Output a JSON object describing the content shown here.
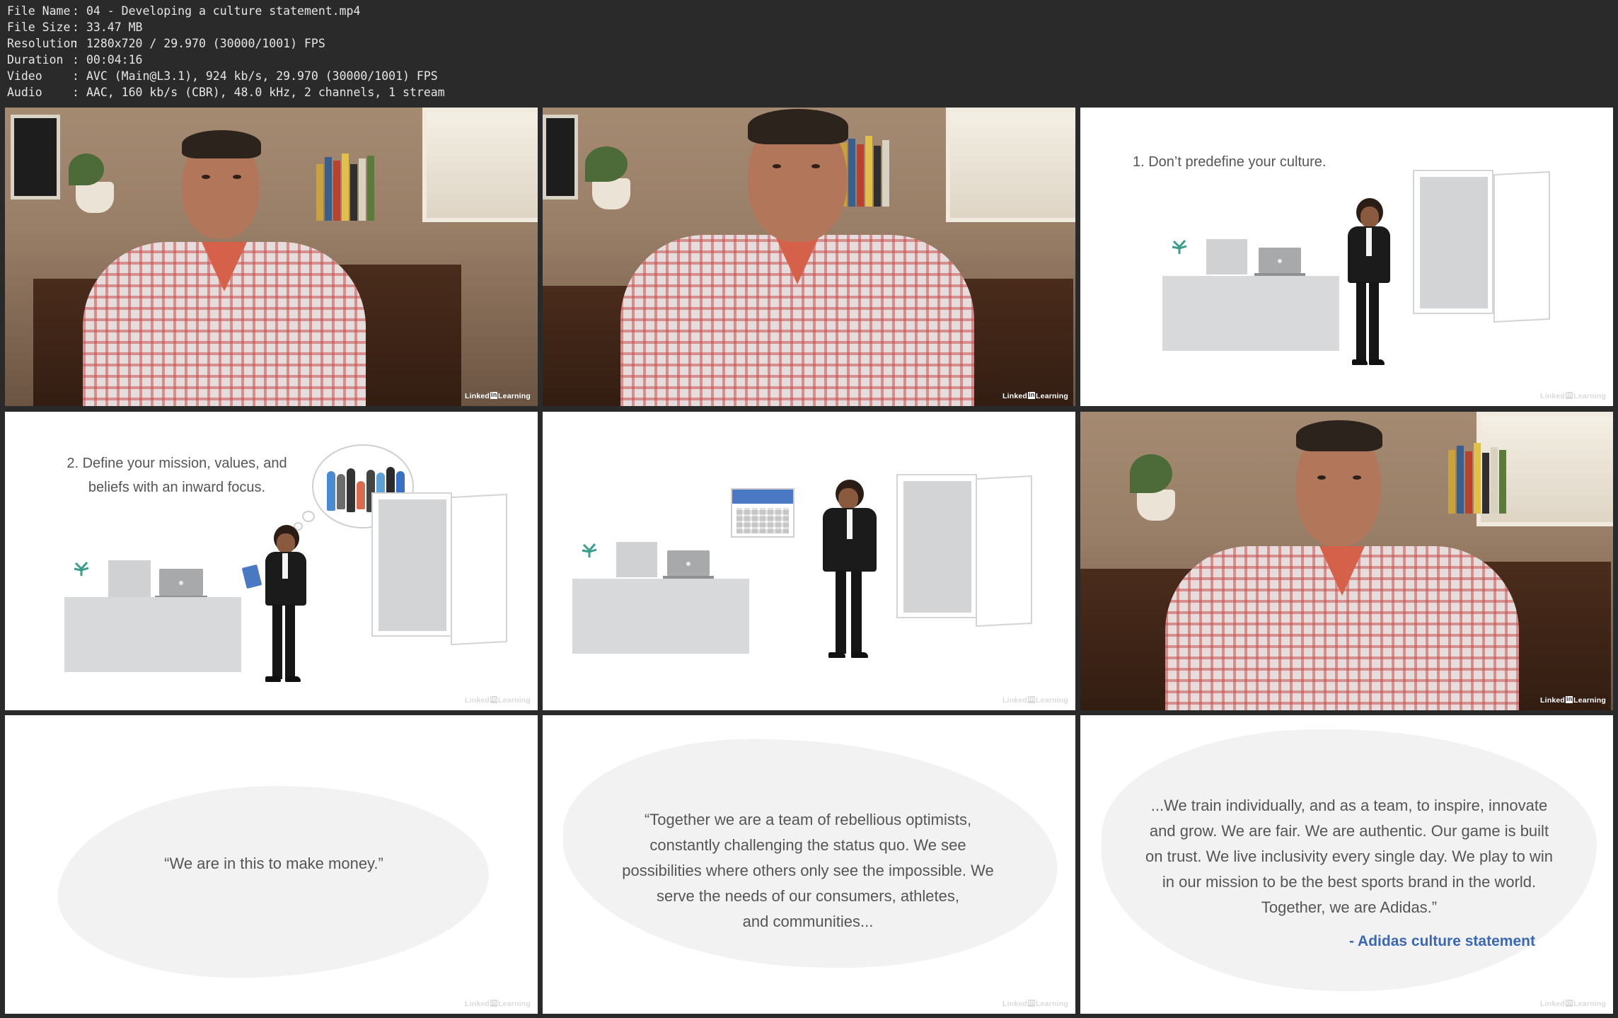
{
  "media_info": [
    {
      "key": "File Name",
      "value": "04 - Developing a culture statement.mp4"
    },
    {
      "key": "File Size",
      "value": "33.47 MB"
    },
    {
      "key": "Resolution",
      "value": "1280x720 / 29.970 (30000/1001) FPS"
    },
    {
      "key": "Duration",
      "value": "00:04:16"
    },
    {
      "key": "Video",
      "value": "AVC (Main@L3.1), 924 kb/s, 29.970 (30000/1001) FPS"
    },
    {
      "key": "Audio",
      "value": "AAC, 160 kb/s (CBR), 48.0 kHz, 2 channels, 1 stream"
    }
  ],
  "separator": ":",
  "watermark": {
    "brand_a": "Linked",
    "brand_box": "in",
    "brand_b": "Learning"
  },
  "slides": {
    "step1_title": "1. Don’t predefine your culture.",
    "step2_title_line1": "2. Define your mission, values, and",
    "step2_title_line2": "beliefs with an inward focus.",
    "quote1": "“We are in this to make money.”",
    "quote2_lines": [
      "“Together we are a team of rebellious optimists,",
      "constantly challenging the status quo. We see",
      "possibilities where others only see the impossible. We",
      "serve the needs of our consumers, athletes,",
      "and communities..."
    ],
    "quote3_lines": [
      "...We train individually, and as a team, to inspire, innovate",
      "and grow. We are fair. We are authentic. Our game is built",
      "on trust. We live inclusivity every single day. We play to win",
      "in our mission to be the best sports brand in the world.",
      "Together, we are Adidas.”"
    ],
    "quote3_attribution": "- Adidas culture statement"
  },
  "colors": {
    "accent_blue": "#3b68b0",
    "calendar_blue": "#4a78c2",
    "background": "#2a2a2a"
  }
}
